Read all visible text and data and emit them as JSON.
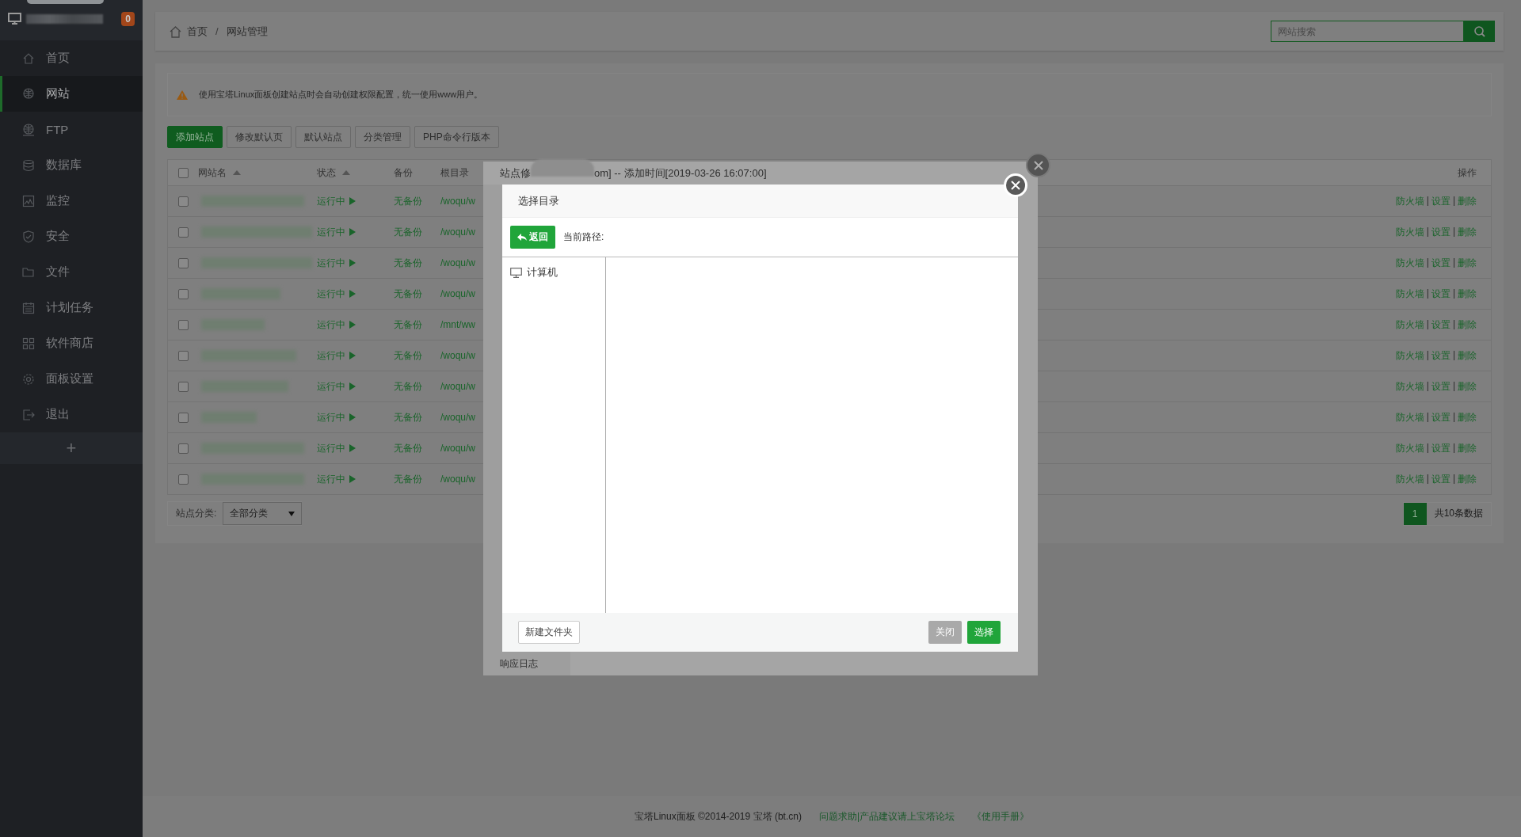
{
  "sidebar": {
    "badge": "0",
    "items": [
      {
        "label": "首页",
        "selected": false
      },
      {
        "label": "网站",
        "selected": true
      },
      {
        "label": "FTP",
        "selected": false
      },
      {
        "label": "数据库",
        "selected": false
      },
      {
        "label": "监控",
        "selected": false
      },
      {
        "label": "安全",
        "selected": false
      },
      {
        "label": "文件",
        "selected": false
      },
      {
        "label": "计划任务",
        "selected": false
      },
      {
        "label": "软件商店",
        "selected": false
      },
      {
        "label": "面板设置",
        "selected": false
      },
      {
        "label": "退出",
        "selected": false
      }
    ],
    "add": "+"
  },
  "breadcrumb": {
    "items": [
      "首页",
      "网站管理"
    ],
    "separator": "/"
  },
  "search": {
    "placeholder": "网站搜索"
  },
  "alert": "使用宝塔Linux面板创建站点时会自动创建权限配置，统一使用www用户。",
  "toolbar": [
    {
      "label": "添加站点",
      "kind": "primary"
    },
    {
      "label": "修改默认页",
      "kind": "default"
    },
    {
      "label": "默认站点",
      "kind": "default"
    },
    {
      "label": "分类管理",
      "kind": "default"
    },
    {
      "label": "PHP命令行版本",
      "kind": "default"
    }
  ],
  "table": {
    "all_checked": false,
    "columns": [
      {
        "label": "网站名",
        "sorted": true
      },
      {
        "label": "状态",
        "sorted": true
      },
      {
        "label": "备份",
        "sorted": false
      },
      {
        "label": "根目录",
        "sorted": false
      },
      {
        "label": "操作",
        "sorted": false
      }
    ],
    "rows": [
      {
        "checked": false,
        "status": "运行中",
        "backup": "无备份",
        "root": "/woqu/w",
        "actions": [
          {
            "kind": "link",
            "label": "防火墙"
          },
          {
            "kind": "separator",
            "label": "|"
          },
          {
            "kind": "link",
            "label": "设置"
          },
          {
            "kind": "separator",
            "label": "|"
          },
          {
            "kind": "link",
            "label": "删除"
          }
        ]
      },
      {
        "checked": false,
        "status": "运行中",
        "backup": "无备份",
        "root": "/woqu/w",
        "actions": [
          {
            "kind": "link",
            "label": "防火墙"
          },
          {
            "kind": "separator",
            "label": "|"
          },
          {
            "kind": "link",
            "label": "设置"
          },
          {
            "kind": "separator",
            "label": "|"
          },
          {
            "kind": "link",
            "label": "删除"
          }
        ]
      },
      {
        "checked": false,
        "status": "运行中",
        "backup": "无备份",
        "root": "/woqu/w",
        "actions": [
          {
            "kind": "link",
            "label": "防火墙"
          },
          {
            "kind": "separator",
            "label": "|"
          },
          {
            "kind": "link",
            "label": "设置"
          },
          {
            "kind": "separator",
            "label": "|"
          },
          {
            "kind": "link",
            "label": "删除"
          }
        ]
      },
      {
        "checked": false,
        "status": "运行中",
        "backup": "无备份",
        "root": "/woqu/w",
        "actions": [
          {
            "kind": "link",
            "label": "防火墙"
          },
          {
            "kind": "separator",
            "label": "|"
          },
          {
            "kind": "link",
            "label": "设置"
          },
          {
            "kind": "separator",
            "label": "|"
          },
          {
            "kind": "link",
            "label": "删除"
          }
        ]
      },
      {
        "checked": false,
        "status": "运行中",
        "backup": "无备份",
        "root": "/mnt/ww",
        "actions": [
          {
            "kind": "link",
            "label": "防火墙"
          },
          {
            "kind": "separator",
            "label": "|"
          },
          {
            "kind": "link",
            "label": "设置"
          },
          {
            "kind": "separator",
            "label": "|"
          },
          {
            "kind": "link",
            "label": "删除"
          }
        ]
      },
      {
        "checked": false,
        "status": "运行中",
        "backup": "无备份",
        "root": "/woqu/w",
        "actions": [
          {
            "kind": "link",
            "label": "防火墙"
          },
          {
            "kind": "separator",
            "label": "|"
          },
          {
            "kind": "link",
            "label": "设置"
          },
          {
            "kind": "separator",
            "label": "|"
          },
          {
            "kind": "link",
            "label": "删除"
          }
        ]
      },
      {
        "checked": false,
        "status": "运行中",
        "backup": "无备份",
        "root": "/woqu/w",
        "actions": [
          {
            "kind": "link",
            "label": "防火墙"
          },
          {
            "kind": "separator",
            "label": "|"
          },
          {
            "kind": "link",
            "label": "设置"
          },
          {
            "kind": "separator",
            "label": "|"
          },
          {
            "kind": "link",
            "label": "删除"
          }
        ]
      },
      {
        "checked": false,
        "status": "运行中",
        "backup": "无备份",
        "root": "/woqu/w",
        "actions": [
          {
            "kind": "link",
            "label": "防火墙"
          },
          {
            "kind": "separator",
            "label": "|"
          },
          {
            "kind": "link",
            "label": "设置"
          },
          {
            "kind": "separator",
            "label": "|"
          },
          {
            "kind": "link",
            "label": "删除"
          }
        ]
      },
      {
        "checked": false,
        "status": "运行中",
        "backup": "无备份",
        "root": "/woqu/w",
        "actions": [
          {
            "kind": "link",
            "label": "防火墙"
          },
          {
            "kind": "separator",
            "label": "|"
          },
          {
            "kind": "link",
            "label": "设置"
          },
          {
            "kind": "separator",
            "label": "|"
          },
          {
            "kind": "link",
            "label": "删除"
          }
        ]
      },
      {
        "checked": false,
        "status": "运行中",
        "backup": "无备份",
        "root": "/woqu/w",
        "actions": [
          {
            "kind": "link",
            "label": "防火墙"
          },
          {
            "kind": "separator",
            "label": "|"
          },
          {
            "kind": "link",
            "label": "设置"
          },
          {
            "kind": "separator",
            "label": "|"
          },
          {
            "kind": "link",
            "label": "删除"
          }
        ]
      }
    ]
  },
  "pagination": {
    "category_label": "站点分类:",
    "category": "全部分类",
    "pages": [
      {
        "label": "1",
        "selected": true
      }
    ],
    "total": "共10条数据"
  },
  "footer": {
    "copyright": "宝塔Linux面板 ©2014-2019 宝塔 (bt.cn)",
    "links": [
      "问题求助|产品建议请上宝塔论坛",
      "《使用手册》"
    ]
  },
  "background_dialog": {
    "title_start": "站点修",
    "title_end": "om] -- 添加时间[2019-03-26 16:07:00]",
    "menu_last": "响应日志"
  },
  "dialog": {
    "title": "选择目录",
    "back": "返回",
    "path_label": "当前路径:",
    "tree": [
      {
        "label": "计算机"
      }
    ],
    "new_folder": "新建文件夹",
    "buttons": [
      {
        "label": "关闭",
        "disabled": true
      },
      {
        "label": "选择",
        "disabled": false
      }
    ]
  }
}
